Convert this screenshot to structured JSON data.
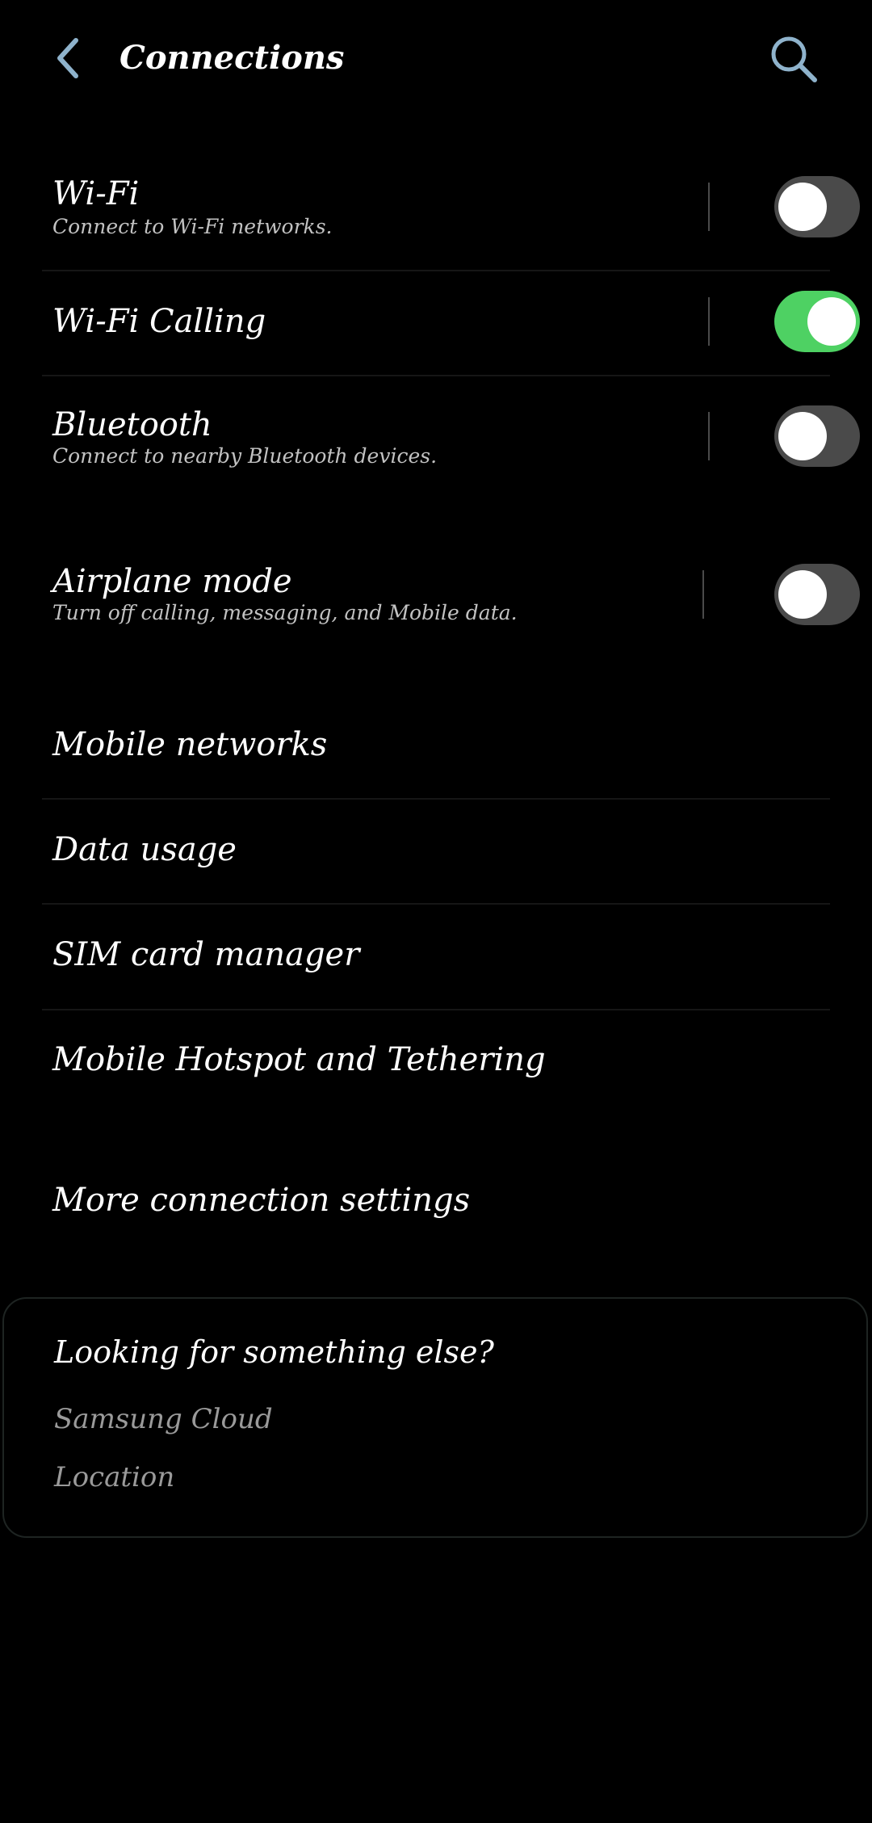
{
  "header": {
    "title": "Connections",
    "back_icon": "chevron-left-icon",
    "search_icon": "search-icon",
    "icon_color": "#8fb3cc"
  },
  "toggles": [
    {
      "title": "Wi-Fi",
      "subtitle": "Connect to Wi-Fi networks.",
      "on": false
    },
    {
      "title": "Wi-Fi Calling",
      "on": true
    },
    {
      "title": "Bluetooth",
      "subtitle": "Connect to nearby Bluetooth devices.",
      "on": false
    },
    {
      "title": "Airplane mode",
      "subtitle": "Turn off calling, messaging, and Mobile data.",
      "on": false
    }
  ],
  "menu": [
    {
      "label": "Mobile networks"
    },
    {
      "label": "Data usage"
    },
    {
      "label": "SIM card manager"
    },
    {
      "label": "Mobile Hotspot and Tethering"
    },
    {
      "label": "More connection settings"
    }
  ],
  "suggestions": {
    "title": "Looking for something else?",
    "links": [
      "Samsung Cloud",
      "Location"
    ]
  },
  "colors": {
    "toggle_on": "#4ed163",
    "toggle_off": "#4a4a4a",
    "background": "#000000"
  }
}
